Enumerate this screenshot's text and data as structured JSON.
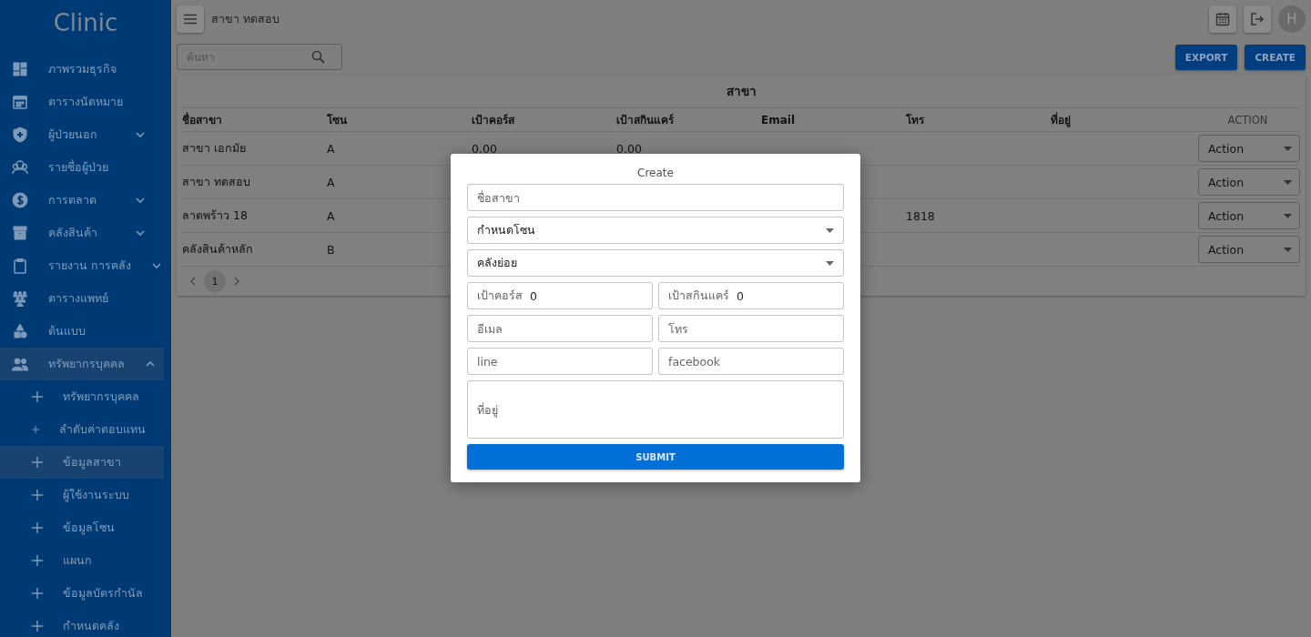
{
  "sidebar": {
    "logo": "Clinic",
    "items": [
      {
        "label": "ภาพรวมธุรกิจ",
        "kind": "link",
        "selected": false
      },
      {
        "label": "ตารางนัดหมาย",
        "kind": "link",
        "selected": false
      },
      {
        "label": "ผู้ป่วยนอก",
        "kind": "group",
        "expanded": false,
        "selected": false
      },
      {
        "label": "รายชื่อผู้ป่วย",
        "kind": "link",
        "selected": false
      },
      {
        "label": "การตลาด",
        "kind": "group",
        "expanded": false,
        "selected": false
      },
      {
        "label": "คลังสินค้า",
        "kind": "group",
        "expanded": false,
        "selected": false
      },
      {
        "label": "รายงาน การคลัง",
        "kind": "group",
        "expanded": false,
        "selected": false
      },
      {
        "label": "ตารางแพทย์",
        "kind": "link",
        "selected": false
      },
      {
        "label": "ต้นแบบ",
        "kind": "link",
        "selected": false
      },
      {
        "label": "ทรัพยากรบุคคล",
        "kind": "group",
        "expanded": true,
        "selected": false,
        "children": [
          {
            "label": "ทรัพยากรบุคคล",
            "selected": false
          },
          {
            "label": "ลำดับค่าตอบแทน",
            "selected": false
          },
          {
            "label": "ข้อมูลสาขา",
            "selected": true
          },
          {
            "label": "ผู้ใช้งานระบบ",
            "selected": false
          },
          {
            "label": "ข้อมูลโซน",
            "selected": false
          },
          {
            "label": "แผนก",
            "selected": false
          },
          {
            "label": "ข้อมูลบัตรกำนัล",
            "selected": false
          },
          {
            "label": "กำหนดคลัง",
            "selected": false
          }
        ]
      }
    ]
  },
  "topbar": {
    "title": "สาขา ทดสอบ",
    "avatar": "H"
  },
  "toolbar": {
    "search": {
      "placeholder": "ค้นหา"
    },
    "buttons": [
      "EXPORT",
      "CREATE"
    ]
  },
  "table": {
    "title": "สาขา",
    "columns": [
      "ชื่อสาขา",
      "โซน",
      "เป้าคอร์ส",
      "เป้าสกินแคร์",
      "Email",
      "โทร",
      "ที่อยู่",
      "ACTION"
    ],
    "rows": [
      {
        "cells": [
          "สาขา เอกมัย",
          "A",
          "0.00",
          "0.00"
        ],
        "action": "Action"
      },
      {
        "cells": [
          "สาขา ทดสอบ",
          "A"
        ],
        "action": "Action"
      },
      {
        "cells": [
          "ลาดพร้าว 18",
          "A",
          null,
          null,
          null,
          "1818"
        ],
        "action": "Action"
      },
      {
        "cells": [
          "คลังสินค้าหลัก",
          "B"
        ],
        "action": "Action"
      }
    ],
    "pages": [
      {
        "label": "1",
        "selected": true
      }
    ]
  },
  "dialog": {
    "title": "Create",
    "rows": [
      [
        {
          "kind": "text",
          "placeholder": "ชื่อสาขา"
        }
      ],
      [
        {
          "kind": "select",
          "value": "กำหนดโซน"
        }
      ],
      [
        {
          "kind": "select",
          "value": "คลังย่อย"
        }
      ],
      [
        {
          "kind": "labeled",
          "label": "เป้าคอร์ส",
          "value": "0"
        },
        {
          "kind": "labeled",
          "label": "เป้าสกินแคร์",
          "value": "0"
        }
      ],
      [
        {
          "kind": "text",
          "placeholder": "อีเมล"
        },
        {
          "kind": "text",
          "placeholder": "โทร"
        }
      ],
      [
        {
          "kind": "text",
          "placeholder": "line"
        },
        {
          "kind": "text",
          "placeholder": "facebook"
        }
      ],
      [
        {
          "kind": "textarea",
          "placeholder": "ที่อยู่"
        }
      ]
    ],
    "submit": "SUBMIT"
  }
}
